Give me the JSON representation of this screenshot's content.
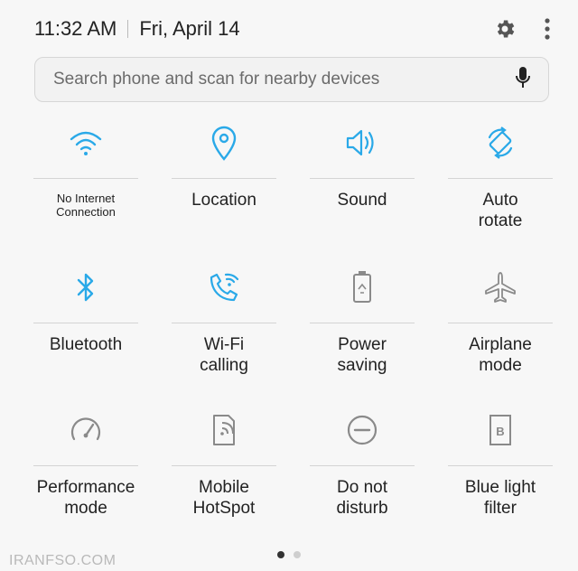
{
  "status": {
    "time": "11:32 AM",
    "date": "Fri, April 14"
  },
  "search": {
    "placeholder": "Search phone and scan for nearby devices"
  },
  "tiles": [
    {
      "label": "No Internet\nConnection",
      "icon": "wifi-icon",
      "active": true
    },
    {
      "label": "Location",
      "icon": "location-icon",
      "active": true
    },
    {
      "label": "Sound",
      "icon": "sound-icon",
      "active": true
    },
    {
      "label": "Auto\nrotate",
      "icon": "auto-rotate-icon",
      "active": true
    },
    {
      "label": "Bluetooth",
      "icon": "bluetooth-icon",
      "active": true
    },
    {
      "label": "Wi-Fi\ncalling",
      "icon": "wifi-calling-icon",
      "active": true
    },
    {
      "label": "Power\nsaving",
      "icon": "power-saving-icon",
      "active": false
    },
    {
      "label": "Airplane\nmode",
      "icon": "airplane-icon",
      "active": false
    },
    {
      "label": "Performance\nmode",
      "icon": "performance-icon",
      "active": false
    },
    {
      "label": "Mobile\nHotSpot",
      "icon": "hotspot-icon",
      "active": false
    },
    {
      "label": "Do not\ndisturb",
      "icon": "do-not-disturb-icon",
      "active": false
    },
    {
      "label": "Blue light\nfilter",
      "icon": "blue-light-filter-icon",
      "active": false
    }
  ],
  "pager": {
    "total": 2,
    "current": 1
  },
  "watermark": "IRANFSO.COM",
  "colors": {
    "active": "#2aa9e8",
    "inactive": "#8a8a8a",
    "background": "#f7f7f7"
  }
}
